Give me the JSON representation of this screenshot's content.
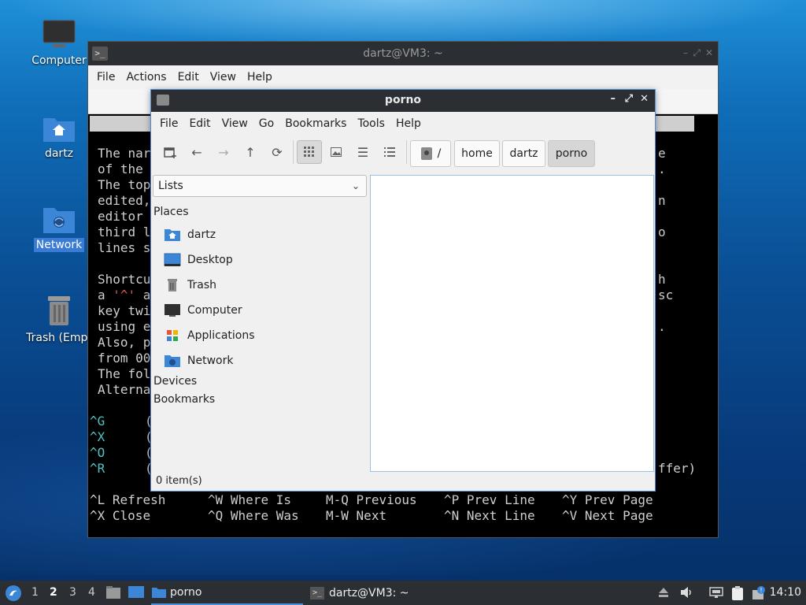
{
  "desktop": {
    "icons": [
      {
        "label": "Computer"
      },
      {
        "label": "dartz"
      },
      {
        "label": "Network"
      },
      {
        "label": "Trash (Empt"
      }
    ]
  },
  "terminal": {
    "title": "dartz@VM3: ~",
    "menu": [
      "File",
      "Actions",
      "Edit",
      "View",
      "Help"
    ],
    "text_lines": [
      "The nar",
      "of the ",
      "The top",
      "edited,",
      "editor ",
      "third l",
      "lines s",
      "Shortcu",
      "key twi",
      "using e",
      "Also, p",
      "from 00",
      "The fol",
      "Alterna"
    ],
    "caret_line_prefix": "a ",
    "caret_token": "'^'",
    "caret_line_suffix": " a",
    "right_fragments": [
      "e",
      ".",
      "n",
      "o",
      "h",
      "sc",
      ".",
      "ffer)"
    ],
    "shortcut_keys": [
      "^G",
      "^X",
      "^O",
      "^R"
    ],
    "shortcut_paren": "(",
    "footer_row1": [
      {
        "key": "^L",
        "label": "Refresh"
      },
      {
        "key": "^W",
        "label": "Where Is"
      },
      {
        "key": "M-Q",
        "label": "Previous"
      },
      {
        "key": "^P",
        "label": "Prev Line"
      },
      {
        "key": "^Y",
        "label": "Prev Page"
      }
    ],
    "footer_row2": [
      {
        "key": "^X",
        "label": "Close"
      },
      {
        "key": "^Q",
        "label": "Where Was"
      },
      {
        "key": "M-W",
        "label": "Next"
      },
      {
        "key": "^N",
        "label": "Next Line"
      },
      {
        "key": "^V",
        "label": "Next Page"
      }
    ]
  },
  "filemanager": {
    "title": "porno",
    "menu": [
      "File",
      "Edit",
      "View",
      "Go",
      "Bookmarks",
      "Tools",
      "Help"
    ],
    "path": [
      "/",
      "home",
      "dartz",
      "porno"
    ],
    "side_mode": "Lists",
    "places_header": "Places",
    "places": [
      "dartz",
      "Desktop",
      "Trash",
      "Computer",
      "Applications",
      "Network"
    ],
    "devices_header": "Devices",
    "bookmarks_header": "Bookmarks",
    "status": "0 item(s)"
  },
  "taskbar": {
    "workspaces": [
      "1",
      "2",
      "3",
      "4"
    ],
    "current_workspace": "2",
    "tasks": [
      {
        "label": "porno"
      },
      {
        "label": "dartz@VM3: ~"
      }
    ],
    "clock": "14:10"
  },
  "colors": {
    "accent": "#4a90d9",
    "titlebar": "#2b2e33",
    "terminal_cyan": "#4fc3c3"
  }
}
